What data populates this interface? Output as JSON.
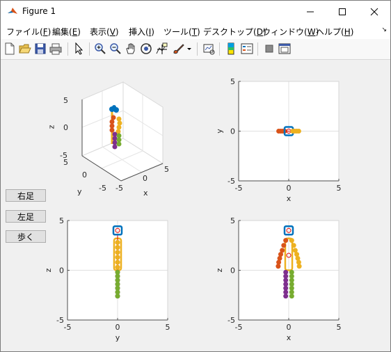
{
  "window": {
    "title": "Figure 1",
    "controls": {
      "minimize": "minimize",
      "maximize": "maximize",
      "close": "close"
    }
  },
  "menu": [
    {
      "label": "ファイル(",
      "key": "F",
      "tail": ")"
    },
    {
      "label": "編集(",
      "key": "E",
      "tail": ")"
    },
    {
      "label": "表示(",
      "key": "V",
      "tail": ")"
    },
    {
      "label": "挿入(",
      "key": "I",
      "tail": ")"
    },
    {
      "label": "ツール(",
      "key": "T",
      "tail": ")"
    },
    {
      "label": "デスクトップ(",
      "key": "D",
      "tail": ")"
    },
    {
      "label": "ウィンドウ(",
      "key": "W",
      "tail": ")"
    },
    {
      "label": "ヘルプ(",
      "key": "H",
      "tail": ")"
    }
  ],
  "toolbar": {
    "icons": [
      "new-figure-icon",
      "open-icon",
      "save-icon",
      "print-icon",
      "pointer-icon",
      "zoom-in-icon",
      "zoom-out-icon",
      "pan-icon",
      "rotate-3d-icon",
      "data-cursor-icon",
      "brush-icon",
      "link-plot-icon",
      "colorbar-icon",
      "legend-icon",
      "hide-plot-tools-icon",
      "show-plot-tools-icon"
    ]
  },
  "buttons": {
    "right_foot": "右足",
    "left_foot": "左足",
    "walk": "歩く"
  },
  "colors": {
    "blue": "#0072bd",
    "orange": "#d95319",
    "yellow": "#edb120",
    "purple": "#7e2f8e",
    "green": "#77ac30",
    "red": "#e00000"
  },
  "chart_data": [
    {
      "type": "scatter",
      "view": "3d",
      "xlabel": "x",
      "ylabel": "y",
      "zlabel": "z",
      "xlim": [
        -5,
        5
      ],
      "ylim": [
        -5,
        5
      ],
      "zlim": [
        -5,
        5
      ],
      "xticks": [
        "-5",
        "0",
        "5"
      ],
      "yticks": [
        "-5",
        "0",
        "5"
      ],
      "zticks": [
        "-5",
        "0",
        "5"
      ],
      "grid": true
    },
    {
      "type": "scatter",
      "view": "top (x-y)",
      "xlabel": "x",
      "ylabel": "y",
      "xlim": [
        -5,
        5
      ],
      "ylim": [
        -5,
        5
      ],
      "xticks": [
        "-5",
        "0",
        "5"
      ],
      "yticks": [
        "-5",
        "0",
        "5"
      ],
      "grid": true,
      "series": [
        {
          "color": "orange",
          "x": [
            -1.0,
            -0.8,
            -0.6,
            -0.4
          ],
          "y": [
            0,
            0,
            0,
            0
          ]
        },
        {
          "color": "blue",
          "x": [
            0
          ],
          "y": [
            0
          ]
        },
        {
          "color": "yellow",
          "x": [
            0.4,
            0.6,
            0.8,
            1.0
          ],
          "y": [
            0,
            0,
            0,
            0
          ]
        }
      ]
    },
    {
      "type": "scatter",
      "view": "side (y-z)",
      "xlabel": "y",
      "ylabel": "z",
      "xlim": [
        -5,
        5
      ],
      "ylim": [
        -5,
        5
      ],
      "xticks": [
        "-5",
        "0",
        "5"
      ],
      "yticks": [
        "-5",
        "0",
        "5"
      ],
      "grid": true,
      "series": [
        {
          "color": "blue",
          "x": [
            0
          ],
          "y": [
            4.0
          ]
        },
        {
          "color": "orange",
          "x": [
            0,
            0,
            0,
            0,
            0,
            0
          ],
          "y": [
            2.8,
            2.3,
            1.8,
            1.3,
            0.8,
            0.3
          ]
        },
        {
          "color": "yellow",
          "x": [
            0,
            0,
            0,
            0,
            0,
            0
          ],
          "y": [
            2.8,
            2.3,
            1.8,
            1.3,
            0.8,
            0.3
          ]
        },
        {
          "color": "purple",
          "x": [
            0,
            0,
            0,
            0,
            0,
            0,
            0
          ],
          "y": [
            -0.2,
            -0.6,
            -1.0,
            -1.4,
            -1.8,
            -2.2,
            -2.6
          ]
        },
        {
          "color": "green",
          "x": [
            0,
            0,
            0,
            0,
            0,
            0,
            0
          ],
          "y": [
            -0.2,
            -0.6,
            -1.0,
            -1.4,
            -1.8,
            -2.2,
            -2.6
          ]
        }
      ]
    },
    {
      "type": "scatter",
      "view": "front (x-z)",
      "xlabel": "x",
      "ylabel": "z",
      "xlim": [
        -5,
        5
      ],
      "ylim": [
        -5,
        5
      ],
      "xticks": [
        "-5",
        "0",
        "5"
      ],
      "yticks": [
        "-5",
        "0",
        "5"
      ],
      "grid": true,
      "series": [
        {
          "color": "blue",
          "x": [
            0
          ],
          "y": [
            4.0
          ]
        },
        {
          "color": "orange",
          "x": [
            -0.3,
            -0.5,
            -0.65,
            -0.8,
            -0.9,
            -1.0,
            -1.05
          ],
          "y": [
            3.0,
            2.5,
            2.0,
            1.6,
            1.2,
            0.8,
            0.4
          ]
        },
        {
          "color": "yellow",
          "x": [
            0.3,
            0.5,
            0.65,
            0.8,
            0.9,
            1.0,
            1.05
          ],
          "y": [
            3.0,
            2.5,
            2.0,
            1.6,
            1.2,
            0.8,
            0.4
          ]
        },
        {
          "color": "purple",
          "x": [
            -0.3,
            -0.3,
            -0.3,
            -0.3,
            -0.3,
            -0.3,
            -0.3
          ],
          "y": [
            -0.2,
            -0.6,
            -1.0,
            -1.4,
            -1.8,
            -2.2,
            -2.6
          ]
        },
        {
          "color": "green",
          "x": [
            0.3,
            0.3,
            0.3,
            0.3,
            0.3,
            0.3,
            0.3
          ],
          "y": [
            -0.2,
            -0.6,
            -1.0,
            -1.4,
            -1.8,
            -2.2,
            -2.6
          ]
        }
      ]
    }
  ]
}
